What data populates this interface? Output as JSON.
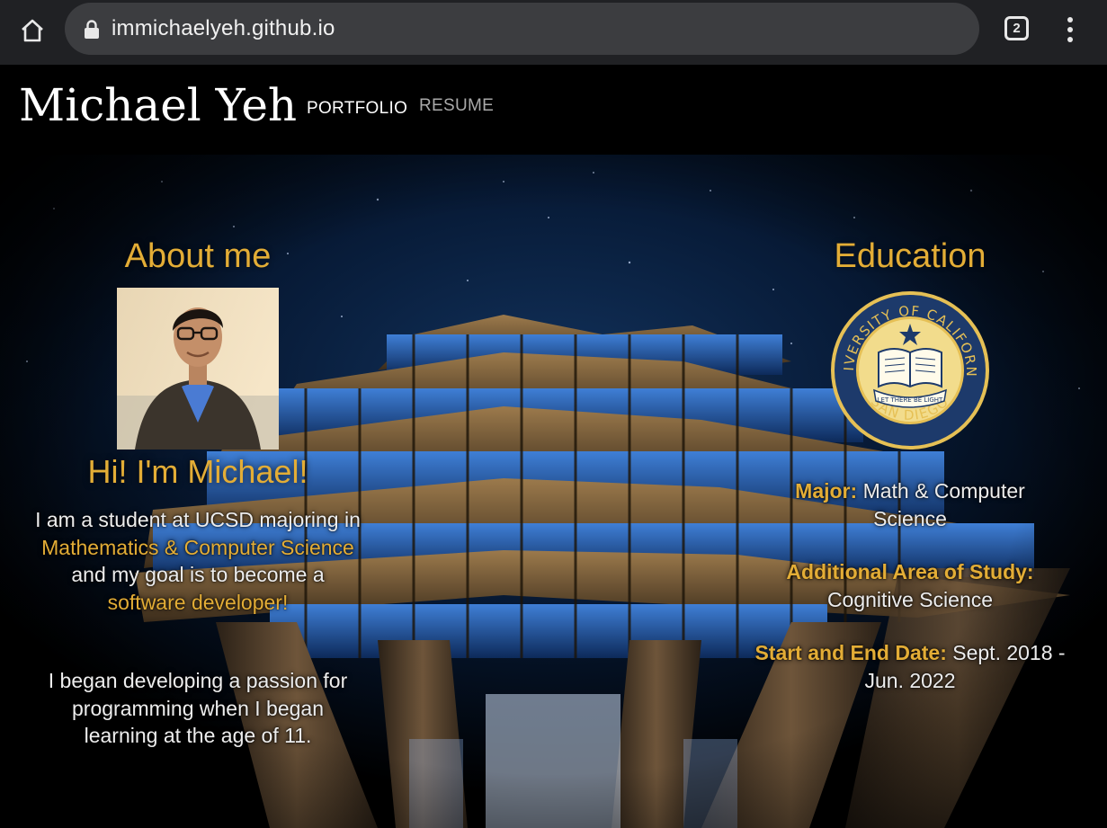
{
  "browser": {
    "url": "immichaelyeh.github.io",
    "tab_count": "2",
    "icons": [
      "home-icon",
      "lock-icon",
      "tab-switcher-icon",
      "more-vert-icon"
    ]
  },
  "site": {
    "title": "Michael Yeh",
    "nav": {
      "portfolio": "PORTFOLIO",
      "resume": "RESUME"
    }
  },
  "about": {
    "heading": "About me",
    "greeting": "Hi! I'm Michael!",
    "intro": {
      "part1": "I am a student at UCSD majoring in ",
      "highlight1": "Mathematics & Computer Science",
      "part2": " and my goal is to become a ",
      "highlight2": "software developer!"
    },
    "passage": "I began developing a passion for programming when I began learning at the age of 11."
  },
  "education": {
    "heading": "Education",
    "seal": {
      "ring_top": "UNIVERSITY OF CALIFORNIA",
      "ring_bottom": "SAN DIEGO",
      "banner": "LET THERE BE LIGHT"
    },
    "major_label": "Major:",
    "major_value": "Math & Computer Science",
    "additional_label": "Additional Area of Study:",
    "additional_value": "Cognitive Science",
    "dates_label": "Start and End Date:",
    "dates_value": "Sept. 2018 - Jun. 2022"
  },
  "colors": {
    "accent": "#e3ad36",
    "chrome": "#202124",
    "urlbar": "#3c3d40",
    "seal_blue": "#1d3a6b",
    "seal_gold": "#e6c055"
  }
}
